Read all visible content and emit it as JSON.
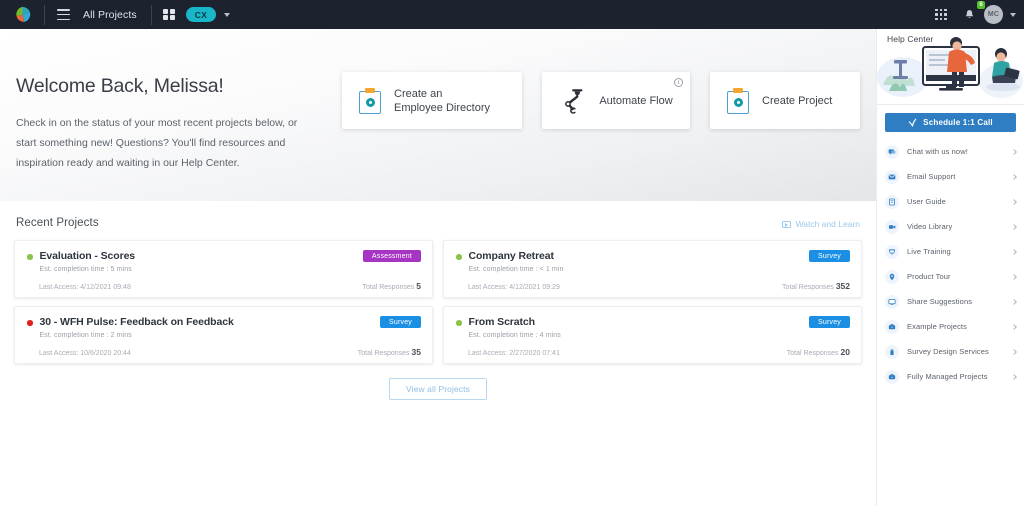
{
  "topbar": {
    "logo_icon": "pie-logo-icon",
    "menu_icon": "hamburger-menu-icon",
    "all_projects_label": "All Projects",
    "grid_icon": "grid-view-icon",
    "workspace_badge": "CX",
    "workspace_caret_icon": "chevron-down-icon",
    "apps_icon": "apps-grid-icon",
    "bell_icon": "notification-bell-icon",
    "notification_count": "6",
    "avatar_initials": "MC",
    "avatar_caret_icon": "chevron-down-icon"
  },
  "hero": {
    "title": "Welcome Back, Melissa!",
    "subtitle": "Check in on the status of your most recent projects below, or start something new! Questions? You'll find resources and inspiration ready and waiting in our Help Center.",
    "cards": [
      {
        "label": "Create an\nEmployee Directory",
        "icon": "clipboard-icon",
        "info": false
      },
      {
        "label": "Automate Flow",
        "icon": "robot-arm-icon",
        "info": true,
        "info_icon": "info-circle-icon"
      },
      {
        "label": "Create Project",
        "icon": "clipboard-icon",
        "info": false
      }
    ]
  },
  "recent": {
    "title": "Recent Projects",
    "watch_label": "Watch and Learn",
    "watch_icon": "video-play-icon",
    "view_all_label": "View all Projects",
    "last_access_prefix": "Last Access:",
    "total_responses_label": "Total Responses",
    "projects": [
      {
        "name": "Evaluation - Scores",
        "est": "Est. completion time : 5 mins",
        "last_access": "Last Access: 4/12/2021 09:48",
        "responses_label": "Total Responses",
        "responses": "5",
        "badge": "Assessment",
        "badge_color": "#a635c4",
        "status_color": "#8bc34a"
      },
      {
        "name": "Company Retreat",
        "est": "Est. completion time : < 1 min",
        "last_access": "Last Access: 4/12/2021 09:29",
        "responses_label": "Total Responses",
        "responses": "352",
        "badge": "Survey",
        "badge_color": "#1a8fe3",
        "status_color": "#8bc34a"
      },
      {
        "name": "30 - WFH Pulse: Feedback on Feedback",
        "est": "Est. completion time : 2 mins",
        "last_access": "Last Access: 10/6/2020 20:44",
        "responses_label": "Total Responses",
        "responses": "35",
        "badge": "Survey",
        "badge_color": "#1a8fe3",
        "status_color": "#e02020"
      },
      {
        "name": "From Scratch",
        "est": "Est. completion time : 4 mins",
        "last_access": "Last Access: 2/27/2020 07:41",
        "responses_label": "Total Responses",
        "responses": "20",
        "badge": "Survey",
        "badge_color": "#1a8fe3",
        "status_color": "#8bc34a"
      }
    ]
  },
  "help": {
    "title": "Help Center",
    "schedule_label": "Schedule 1:1 Call",
    "schedule_icon": "calendar-check-icon",
    "items": [
      {
        "label": "Chat with us now!",
        "icon": "chat-bubble-icon"
      },
      {
        "label": "Email Support",
        "icon": "envelope-icon"
      },
      {
        "label": "User Guide",
        "icon": "book-icon"
      },
      {
        "label": "Video Library",
        "icon": "video-camera-icon"
      },
      {
        "label": "Live Training",
        "icon": "podium-icon"
      },
      {
        "label": "Product Tour",
        "icon": "map-pin-icon"
      },
      {
        "label": "Share Suggestions",
        "icon": "monitor-icon"
      },
      {
        "label": "Example Projects",
        "icon": "briefcase-icon"
      },
      {
        "label": "Survey Design Services",
        "icon": "pencil-ruler-icon"
      },
      {
        "label": "Fully Managed Projects",
        "icon": "folder-icon"
      }
    ]
  },
  "colors": {
    "topbar_bg": "#1d232e",
    "accent_blue": "#2f7ec4",
    "badge_purple": "#a635c4",
    "badge_blue": "#1a8fe3",
    "teal": "#19b6c9"
  }
}
